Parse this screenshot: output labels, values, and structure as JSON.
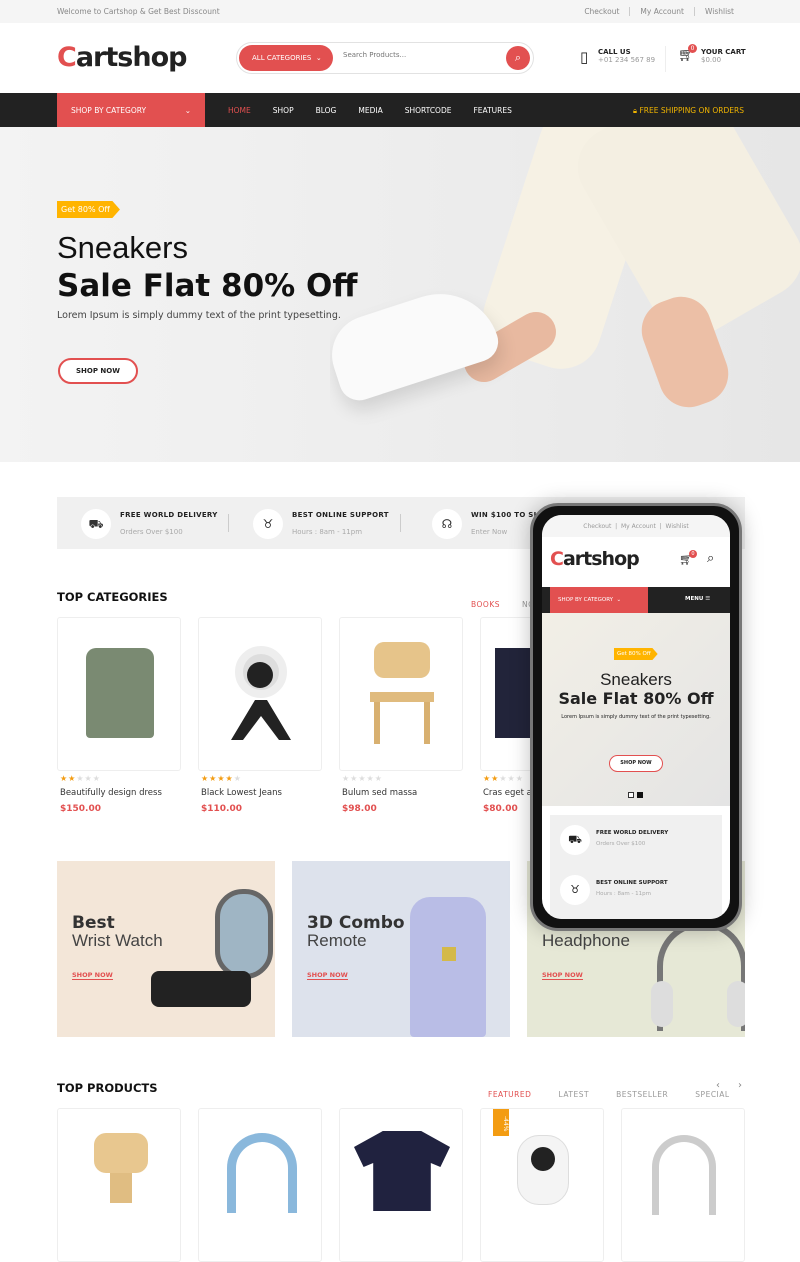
{
  "topbar": {
    "welcome": "Welcome to Cartshop & Get Best Disscount",
    "links": [
      "Checkout",
      "My Account",
      "Wishlist"
    ]
  },
  "header": {
    "logo": "Cartshop",
    "search": {
      "category": "ALL CATEGORIES",
      "placeholder": "Search Products..."
    },
    "call_label": "CALL US",
    "call_number": "+01 234 567 89",
    "cart_label": "YOUR CART",
    "cart_total": "$0.00",
    "cart_count": "0"
  },
  "nav": {
    "shop_by_category": "SHOP BY CATEGORY",
    "items": [
      "HOME",
      "SHOP",
      "BLOG",
      "MEDIA",
      "SHORTCODE",
      "FEATURES"
    ],
    "shipping": "FREE SHIPPING ON ORDERS",
    "accent": "#e25050"
  },
  "hero": {
    "badge": "Get 80% Off",
    "title1": "Sneakers",
    "title2": "Sale Flat 80% Off",
    "text": "Lorem Ipsum is simply dummy text of the print typesetting.",
    "button": "SHOP NOW"
  },
  "features": [
    {
      "icon": "truck-icon",
      "title": "FREE WORLD DELIVERY",
      "sub": "Orders Over $100"
    },
    {
      "icon": "piggy-bank-icon",
      "title": "BEST ONLINE SUPPORT",
      "sub": "Hours : 8am - 11pm"
    },
    {
      "icon": "headset-icon",
      "title": "WIN $100 TO SHO",
      "sub": "Enter Now"
    }
  ],
  "top_categories": {
    "title": "TOP CATEGORIES",
    "tabs": [
      "BOOKS",
      "NO"
    ],
    "products": [
      {
        "name": "Beautifully design dress",
        "price": "$150.00",
        "rating": 2
      },
      {
        "name": "Black Lowest Jeans",
        "price": "$110.00",
        "rating": 4
      },
      {
        "name": "Bulum sed massa",
        "price": "$98.00",
        "rating": 0
      },
      {
        "name": "Cras eget a",
        "price": "$80.00",
        "rating": 2
      }
    ]
  },
  "banners": [
    {
      "t1": "Best",
      "t2": "Wrist Watch",
      "link": "SHOP NOW",
      "bg": "#f3e6d8"
    },
    {
      "t1": "3D Combo",
      "t2": "Remote",
      "link": "SHOP NOW",
      "bg": "#dde2ec"
    },
    {
      "t1": "",
      "t2": "Headphone",
      "link": "SHOP NOW",
      "bg": "#e6e8d6"
    }
  ],
  "top_products": {
    "title": "TOP PRODUCTS",
    "tabs": [
      "FEATURED",
      "LATEST",
      "BESTSELLER",
      "SPECIAL"
    ],
    "sale_badge": "-44%"
  },
  "phone": {
    "links": [
      "Checkout",
      "My Account",
      "Wishlist"
    ],
    "logo": "Cartshop",
    "cart_count": "0",
    "shop_by_category": "SHOP BY CATEGORY",
    "menu": "MENU",
    "badge": "Get 80% Off",
    "title1": "Sneakers",
    "title2": "Sale Flat 80% Off",
    "text": "Lorem Ipsum is simply dummy text of the print typesetting.",
    "button": "SHOP NOW",
    "features": [
      {
        "title": "FREE WORLD DELIVERY",
        "sub": "Orders Over $100"
      },
      {
        "title": "BEST ONLINE SUPPORT",
        "sub": "Hours : 8am - 11pm"
      }
    ]
  }
}
